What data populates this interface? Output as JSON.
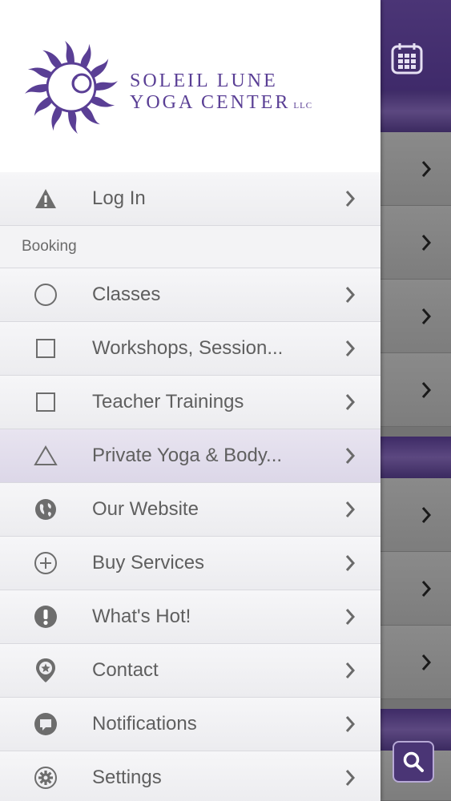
{
  "brand": {
    "line1": "Soleil Lune",
    "line2": "Yoga Center",
    "suffix": "llc",
    "color": "#5a3f95"
  },
  "menu": {
    "login": {
      "label": "Log In",
      "icon": "warning-icon"
    },
    "section_booking": "Booking",
    "items": [
      {
        "label": "Classes",
        "icon": "circle-icon"
      },
      {
        "label": "Workshops, Session...",
        "icon": "square-icon"
      },
      {
        "label": "Teacher Trainings",
        "icon": "square-icon"
      },
      {
        "label": "Private Yoga & Body...",
        "icon": "triangle-icon"
      },
      {
        "label": "Our Website",
        "icon": "globe-icon"
      },
      {
        "label": "Buy Services",
        "icon": "plus-circle-icon"
      },
      {
        "label": "What's Hot!",
        "icon": "exclamation-icon"
      },
      {
        "label": "Contact",
        "icon": "location-star-icon"
      },
      {
        "label": "Notifications",
        "icon": "chat-bubble-icon"
      },
      {
        "label": "Settings",
        "icon": "gear-icon"
      }
    ]
  },
  "background_app": {
    "header_icon": "calendar-icon",
    "search_icon": "search-icon",
    "accent": "#4b3576"
  }
}
